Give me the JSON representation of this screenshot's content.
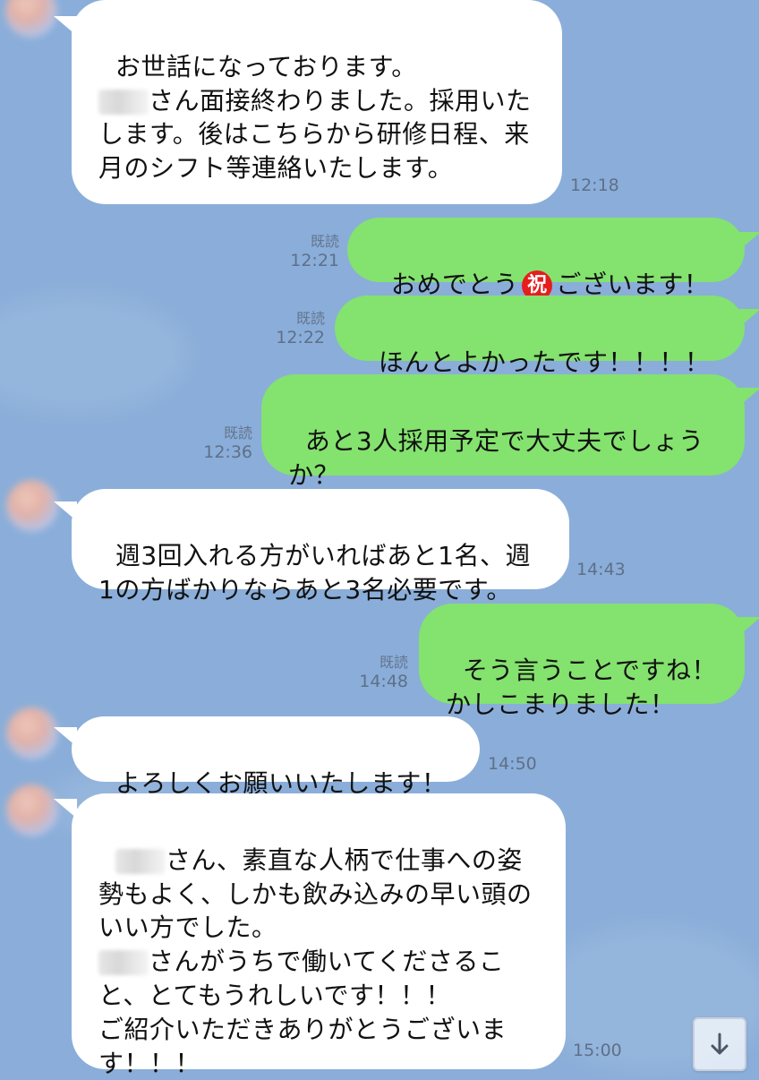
{
  "messages": [
    {
      "side": "left",
      "text_parts": [
        "お世話になっております。\n",
        "[blurred]",
        "さん面接終わりました。採用いたします。後はこちらから研修日程、来月のシフト等連絡いたします。"
      ],
      "time": "12:18"
    },
    {
      "side": "right",
      "text_before": "おめでとう",
      "emoji": "祝",
      "text_after": "ございます！",
      "read": "既読",
      "time": "12:21"
    },
    {
      "side": "right",
      "text": "ほんとよかったです！！！！",
      "read": "既読",
      "time": "12:22"
    },
    {
      "side": "right",
      "text": "あと3人採用予定で大丈夫でしょうか？",
      "read": "既読",
      "time": "12:36"
    },
    {
      "side": "left",
      "text": "週3回入れる方がいればあと1名、週1の方ばかりならあと3名必要です。",
      "time": "14:43"
    },
    {
      "side": "right",
      "text": "そう言うことですね！\nかしこまりました！",
      "read": "既読",
      "time": "14:48"
    },
    {
      "side": "left",
      "text": "よろしくお願いいたします！",
      "time": "14:50"
    },
    {
      "side": "left",
      "text_parts": [
        "[blurred]",
        "さん、素直な人柄で仕事への姿勢もよく、しかも飲み込みの早い頭のいい方でした。\n",
        "[blurred]",
        "さんがうちで働いてくださること、とてもうれしいです！！！\nご紹介いただきありがとうございます！！！"
      ],
      "time": "15:00"
    }
  ],
  "ui": {
    "scroll_button_icon": "arrow-down-icon"
  }
}
